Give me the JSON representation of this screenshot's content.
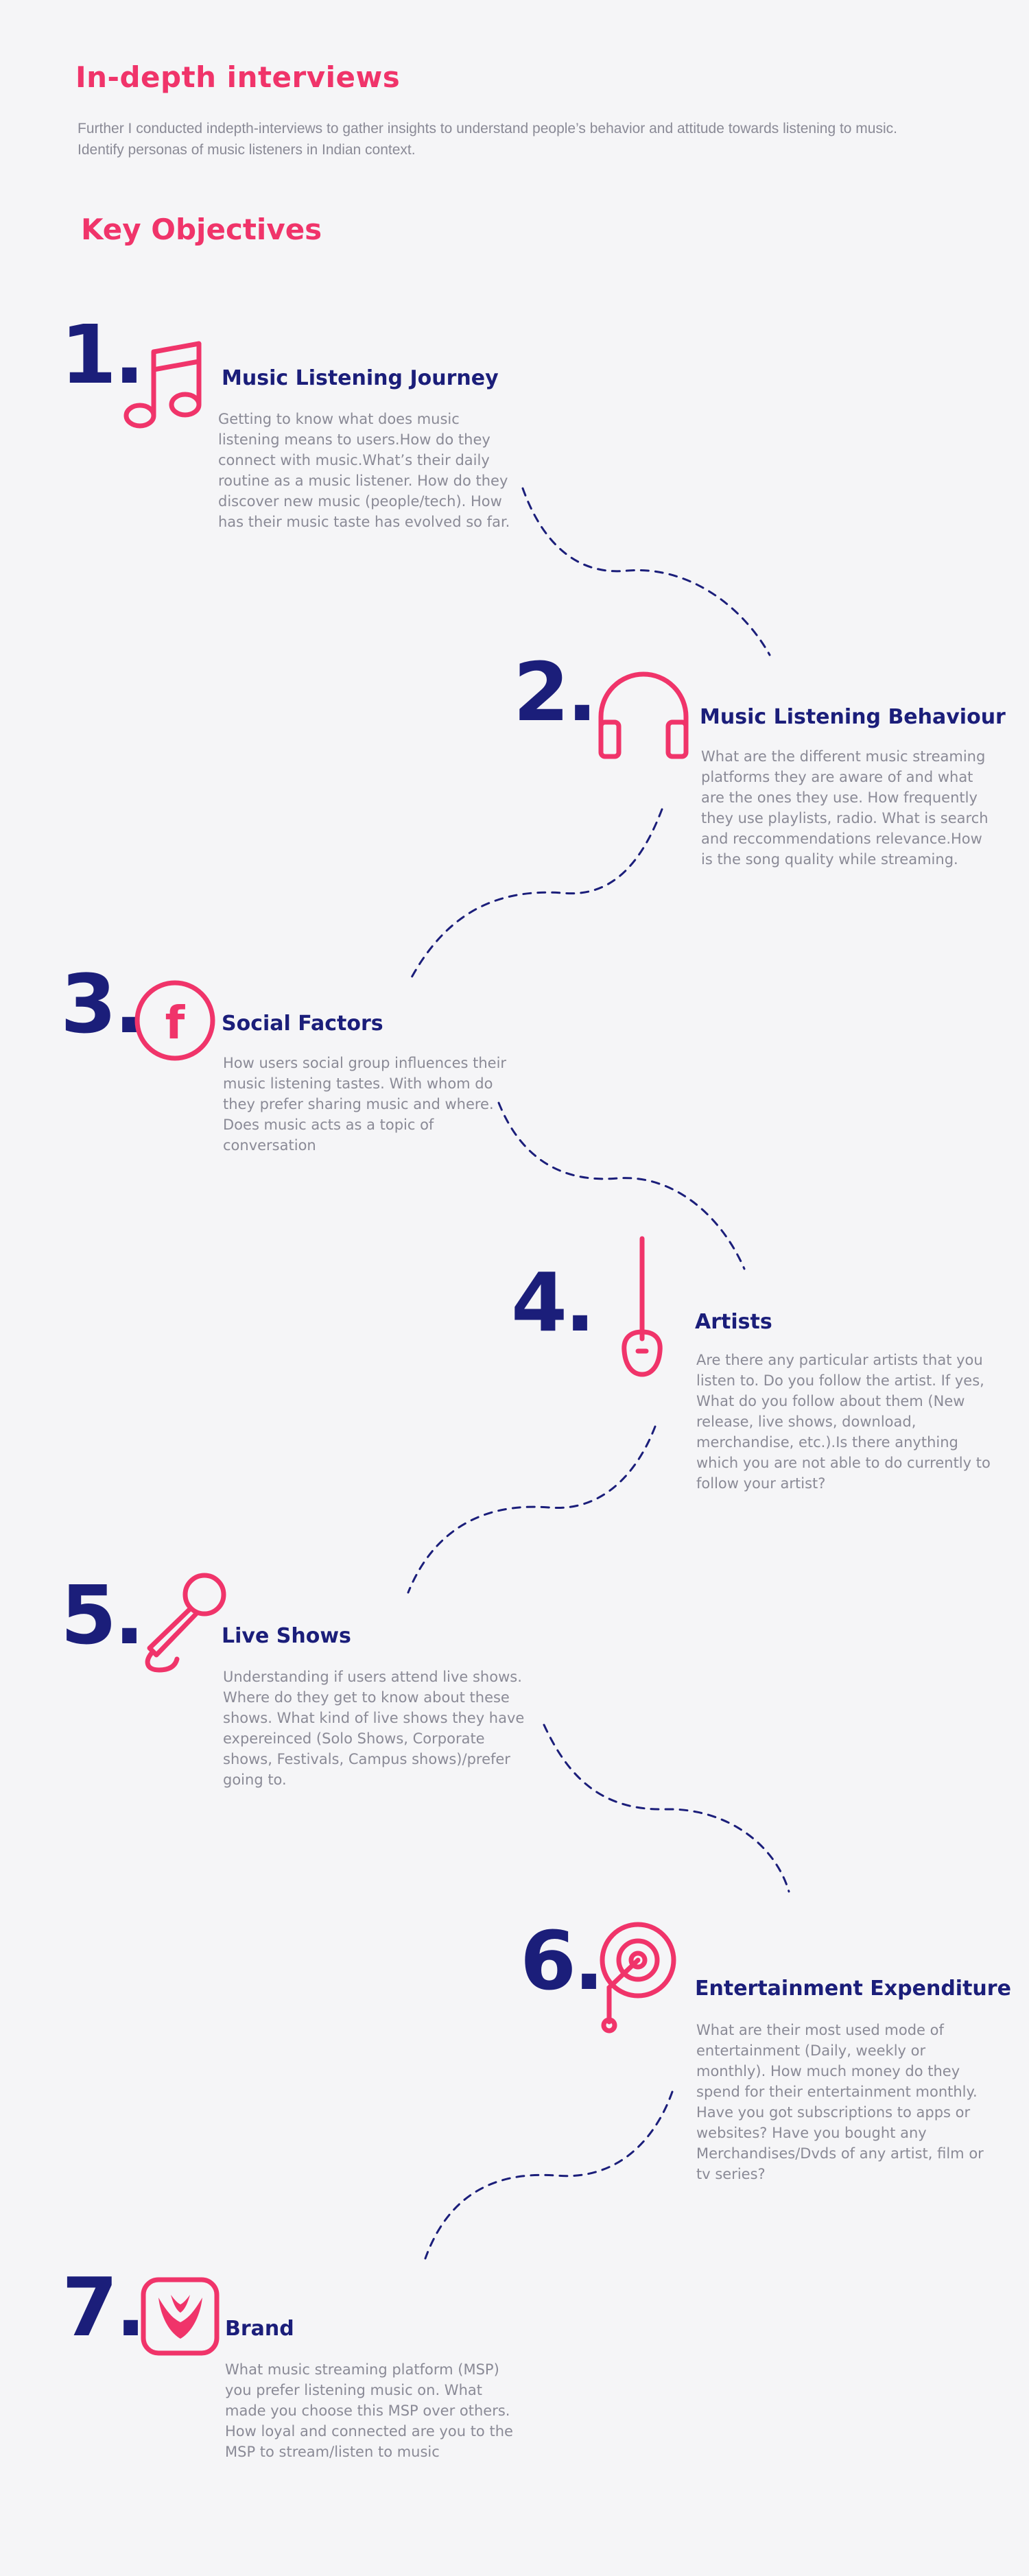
{
  "header": {
    "title": "In-depth interviews",
    "intro": "Further I conducted indepth-interviews to gather insights to understand people’s behavior and attitude towards listening to music. Identify personas of music listeners in Indian context."
  },
  "objectives_heading": "Key Objectives",
  "colors": {
    "accent": "#f0346a",
    "navy": "#1b1e7a",
    "text": "#8a8a96",
    "background": "#f5f5f7"
  },
  "objectives": [
    {
      "number": "1.",
      "icon": "music-note-icon",
      "title": "Music Listening Journey",
      "description": "Getting to know what does music listening means to users.How do they connect with music.What’s their daily routine as a music listener. How do they discover new music (people/tech). How has their music taste has evolved so far."
    },
    {
      "number": "2.",
      "icon": "headphones-icon",
      "title": "Music Listening Behaviour",
      "description": "What are the different music streaming platforms they are aware of and what are the ones they use. How frequently they use playlists, radio. What is search and reccommendations relevance.How is the song quality while streaming."
    },
    {
      "number": "3.",
      "icon": "facebook-icon",
      "title": "Social Factors",
      "description": "How users social group influences their music listening tastes. With whom do they prefer sharing music and where. Does music acts as a topic of conversation"
    },
    {
      "number": "4.",
      "icon": "guitar-icon",
      "title": "Artists",
      "description": "Are there any particular artists that you listen to. Do you follow the artist. If yes, What do you follow about them (New release, live shows, download, merchandise, etc.).Is there anything which you are not able to do currently to follow your artist?"
    },
    {
      "number": "5.",
      "icon": "microphone-icon",
      "title": "Live Shows",
      "description": "Understanding if users attend live shows. Where do they get to know about these shows. What kind of live shows they have expereinced (Solo Shows, Corporate shows, Festivals, Campus shows)/prefer going to."
    },
    {
      "number": "6.",
      "icon": "turntable-icon",
      "title": "Entertainment Expenditure",
      "description": "What are their most used mode of entertainment (Daily, weekly or monthly). How much money do they spend for their entertainment monthly. Have you got subscriptions to apps or websites? Have you bought any Merchandises/Dvds of any artist, film or tv series?"
    }
  ],
  "brand_objective": {
    "number": "7.",
    "icon": "saavn-logo-icon",
    "title": "Brand",
    "description": "What music streaming platform (MSP) you prefer listening music on. What made you choose this MSP over others. How loyal and connected are you to the MSP to stream/listen to music"
  }
}
